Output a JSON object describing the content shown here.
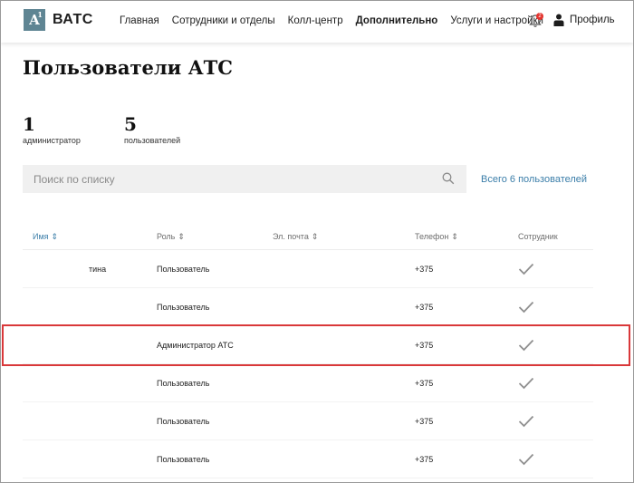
{
  "app": {
    "logo_mark": "A",
    "logo_sup": "1",
    "logo_text": "ВАТС"
  },
  "nav": {
    "items": [
      "Главная",
      "Сотрудники и отделы",
      "Колл-центр",
      "Дополнительно",
      "Услуги и настройки"
    ],
    "active": "Дополнительно"
  },
  "notifications": {
    "count": "2"
  },
  "profile": {
    "label": "Профиль"
  },
  "page": {
    "title": "Пользователи АТС"
  },
  "stats": [
    {
      "value": "1",
      "label": "администратор"
    },
    {
      "value": "5",
      "label": "пользователей"
    }
  ],
  "search": {
    "placeholder": "Поиск по списку",
    "value": ""
  },
  "total_link": "Всего 6 пользователей",
  "table": {
    "columns": [
      "Имя",
      "Роль",
      "Эл. почта",
      "Телефон",
      "Сотрудник"
    ],
    "sort_icon": "⇕",
    "rows": [
      {
        "name": "тина",
        "role": "Пользователь",
        "email": "",
        "phone": "+375",
        "employee": true
      },
      {
        "name": "",
        "role": "Пользователь",
        "email": "",
        "phone": "+375",
        "employee": true
      },
      {
        "name": "",
        "role": "Администратор АТС",
        "email": "",
        "phone": "+375",
        "employee": true
      },
      {
        "name": "",
        "role": "Пользователь",
        "email": "",
        "phone": "+375",
        "employee": true
      },
      {
        "name": "",
        "role": "Пользователь",
        "email": "",
        "phone": "+375",
        "employee": true
      },
      {
        "name": "",
        "role": "Пользователь",
        "email": "",
        "phone": "+375",
        "employee": true
      }
    ],
    "highlighted_row": 2
  },
  "colors": {
    "accent": "#3b7ea9",
    "logo_bg": "#5f8593",
    "highlight": "#d9383a",
    "badge": "#e3322d"
  }
}
